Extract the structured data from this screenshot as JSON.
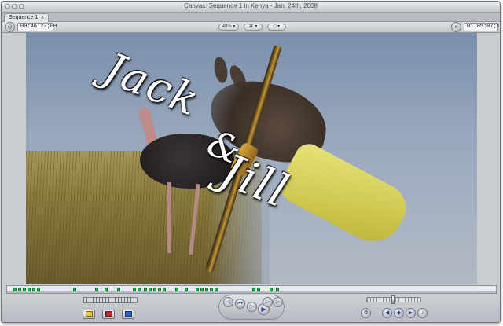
{
  "window": {
    "title": "Canvas: Sequence 1 in Kenya - Jan. 24th, 2008"
  },
  "tabs": [
    {
      "label": "Sequence 1",
      "close": "x"
    }
  ],
  "toolbar": {
    "current_timecode": "00:46:23;00",
    "duration_timecode": "01:05:07;17",
    "zoom_label": "48%",
    "zoom_icon": "chevron-down-icon",
    "view_mode_label": "⌘",
    "overlay_label": "□"
  },
  "canvas": {
    "title_line1": "Jack",
    "title_line2": "&",
    "title_line3": "Jill"
  },
  "transport": {
    "buttons": [
      "mark-in-icon",
      "mark-out-icon",
      "go-to-prev-edit-icon",
      "play-in-to-out-icon",
      "play-icon",
      "play-around-icon",
      "go-to-next-edit-icon"
    ],
    "right_buttons": [
      "match-frame-icon",
      "mark-clip-icon",
      "add-keyframe-icon",
      "add-marker-icon",
      "audio-icon"
    ],
    "left_edit_buttons": [
      "insert-edit",
      "overwrite-edit",
      "replace-edit"
    ]
  },
  "colors": {
    "marker_green": "#25b04a",
    "overwrite_red": "#c0262b",
    "insert_yellow": "#e3c93a",
    "replace_blue": "#2e5fc4"
  }
}
